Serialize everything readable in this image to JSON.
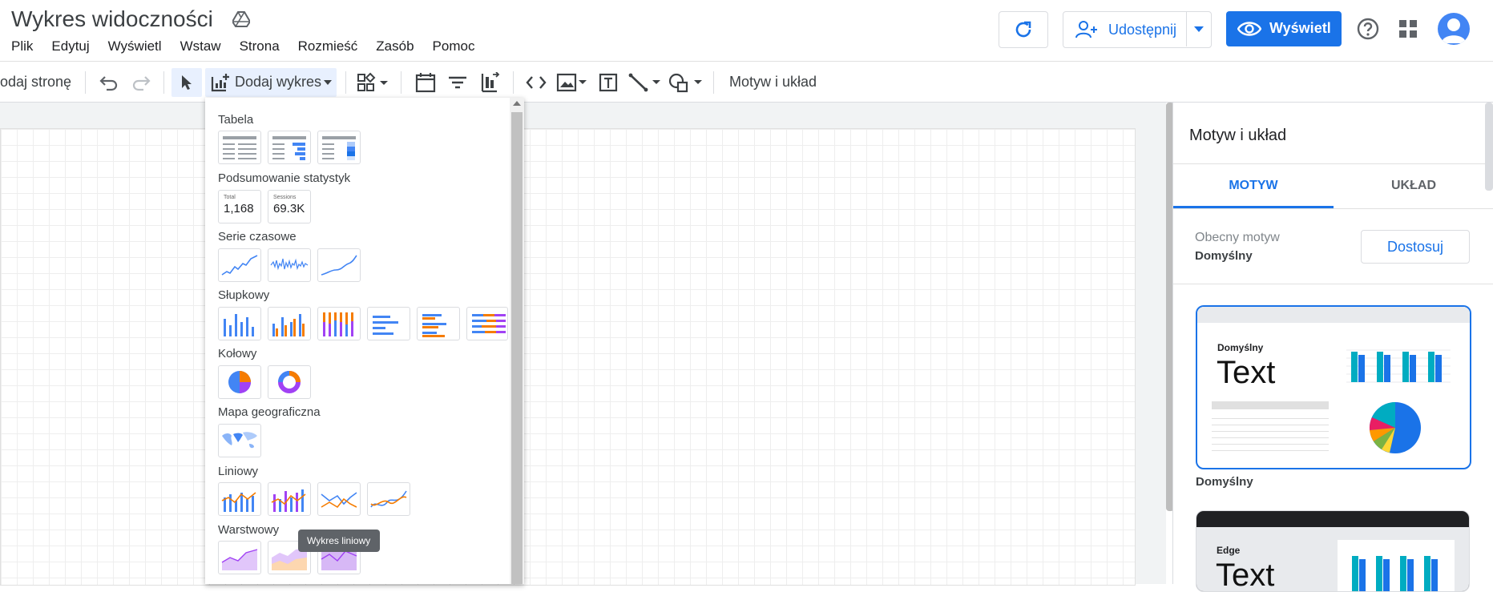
{
  "header": {
    "doc_title": "Wykres widoczności",
    "menu": [
      "Plik",
      "Edytuj",
      "Wyświetl",
      "Wstaw",
      "Strona",
      "Rozmieść",
      "Zasób",
      "Pomoc"
    ],
    "share_label": "Udostępnij",
    "view_label": "Wyświetl"
  },
  "toolbar": {
    "add_page_label": "odaj stronę",
    "add_chart_label": "Dodaj wykres",
    "theme_layout_label": "Motyw i układ"
  },
  "chart_menu": {
    "sections": {
      "table": "Tabela",
      "scorecard": "Podsumowanie statystyk",
      "timeseries": "Serie czasowe",
      "bar": "Słupkowy",
      "pie": "Kołowy",
      "geo": "Mapa geograficzna",
      "line": "Liniowy",
      "area": "Warstwowy"
    },
    "scorecard_tiles": [
      {
        "label": "Total",
        "value": "1,168"
      },
      {
        "label": "Sessions",
        "value": "69.3K"
      }
    ],
    "tooltip": "Wykres liniowy"
  },
  "panel": {
    "title": "Motyw i układ",
    "tabs": [
      "MOTYW",
      "UKŁAD"
    ],
    "current_theme_label": "Obecny motyw",
    "current_theme_value": "Domyślny",
    "customize_label": "Dostosuj",
    "theme_cards": [
      {
        "name": "Domyślny",
        "sample_text": "Text",
        "caption": "Domyślny"
      },
      {
        "name": "Edge",
        "sample_text": "Text"
      }
    ]
  },
  "colors": {
    "accent": "#1a73e8",
    "bar_blue": "#4285f4",
    "bar_orange": "#f57c00",
    "purple": "#a142f4",
    "card_cyan": "#00acc1"
  }
}
